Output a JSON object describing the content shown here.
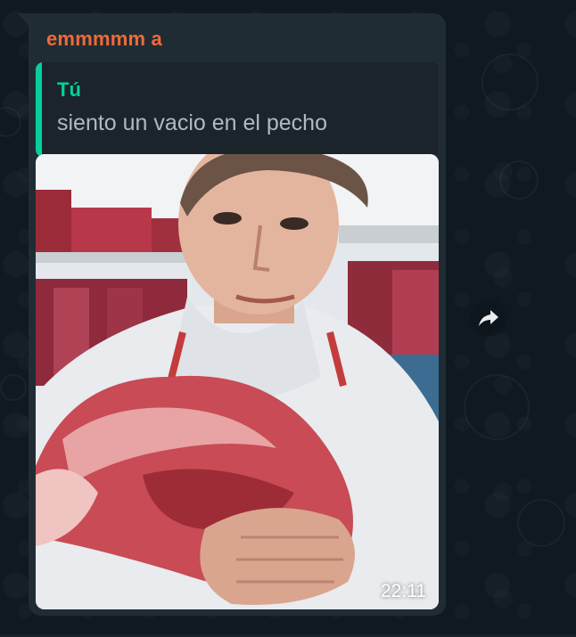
{
  "message": {
    "sender_name": "emmmmm a",
    "quoted_reply": {
      "author": "Tú",
      "text": "siento un vacio en el pecho"
    },
    "timestamp": "22:11",
    "image_alt": "selfie of a man holding a large raw cut of meat"
  },
  "colors": {
    "chat_background": "#0b141a",
    "bubble": "#202c33",
    "sender_name": "#f0693a",
    "quote_accent": "#06cf9c",
    "quote_text": "#aebac1"
  },
  "icons": {
    "forward": "forward-arrow-icon"
  }
}
